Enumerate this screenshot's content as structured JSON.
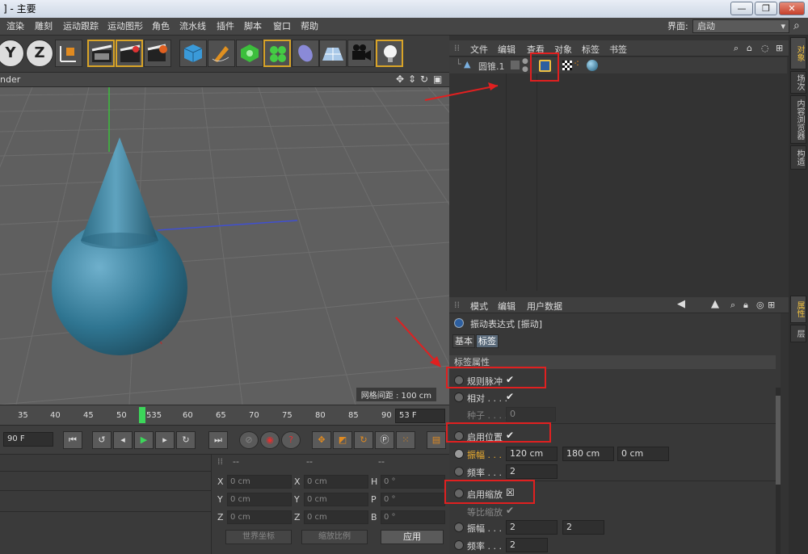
{
  "window": {
    "title": "] - 主要",
    "buttons": [
      "—",
      "❐",
      "✕"
    ]
  },
  "menu": {
    "items": [
      "渲染",
      "雕刻",
      "运动跟踪",
      "运动图形",
      "角色",
      "流水线",
      "插件",
      "脚本",
      "窗口",
      "帮助"
    ],
    "interface_label": "界面:",
    "interface_value": "启动"
  },
  "toolbar": {
    "icons": [
      "y-axis-icon",
      "z-axis-icon",
      "coordinate-system-icon",
      "render-view-icon",
      "render-picture-icon",
      "render-settings-icon",
      "cube-icon",
      "pen-icon",
      "subdivision-icon",
      "cloner-icon",
      "deformer-icon",
      "floor-icon",
      "camera-icon",
      "light-icon"
    ],
    "axis_y": "Y",
    "axis_z": "Z"
  },
  "viewport": {
    "header_text": "nder",
    "grid_label": "网格间距 : 100 cm"
  },
  "timeline": {
    "ticks": [
      "35",
      "40",
      "45",
      "50",
      "535",
      "55",
      "60",
      "65",
      "70",
      "75",
      "80",
      "85",
      "90"
    ],
    "current_frame": "53 F",
    "end_frame": "90 F"
  },
  "object_manager": {
    "menu": [
      "文件",
      "编辑",
      "查看",
      "对象",
      "标签",
      "书签"
    ],
    "object_name": "圆锥.1"
  },
  "attributes": {
    "menu": [
      "模式",
      "编辑",
      "用户数据"
    ],
    "title": "振动表达式 [振动]",
    "tabs": [
      "基本",
      "标签"
    ],
    "section": "标签属性",
    "rows": [
      {
        "label": "规则脉冲",
        "check": "✔"
      },
      {
        "label": "相对 . . . .",
        "check": "✔"
      },
      {
        "label": "种子 . . . .",
        "value": "0"
      },
      {
        "label": "启用位置",
        "check": "✔"
      },
      {
        "label": "振幅 . . .",
        "v1": "120 cm",
        "v2": "180 cm",
        "v3": "0 cm"
      },
      {
        "label": "频率 . . .",
        "v1": "2"
      },
      {
        "label": "启用缩放",
        "check": "☒"
      },
      {
        "label": "等比缩放",
        "check": "✔"
      },
      {
        "label": "振幅 . . .",
        "v1": "2",
        "v2": "2"
      },
      {
        "label": "频率 . . .",
        "v1": "2"
      }
    ]
  },
  "coords": {
    "header": "--",
    "labels": [
      "X",
      "Y",
      "Z",
      "X",
      "Y",
      "Z",
      "H",
      "P",
      "B"
    ],
    "values": [
      "0 cm",
      "0 cm",
      "0 cm",
      "0 cm",
      "0 cm",
      "0 cm",
      "0 °",
      "0 °",
      "0 °"
    ],
    "world_btn": "世界坐标",
    "scale_btn": "缩放比例",
    "apply_btn": "应用"
  },
  "side_tabs": [
    "对象",
    "场次",
    "内容浏览器",
    "构造"
  ],
  "side_tabs2": [
    "属性",
    "层"
  ]
}
